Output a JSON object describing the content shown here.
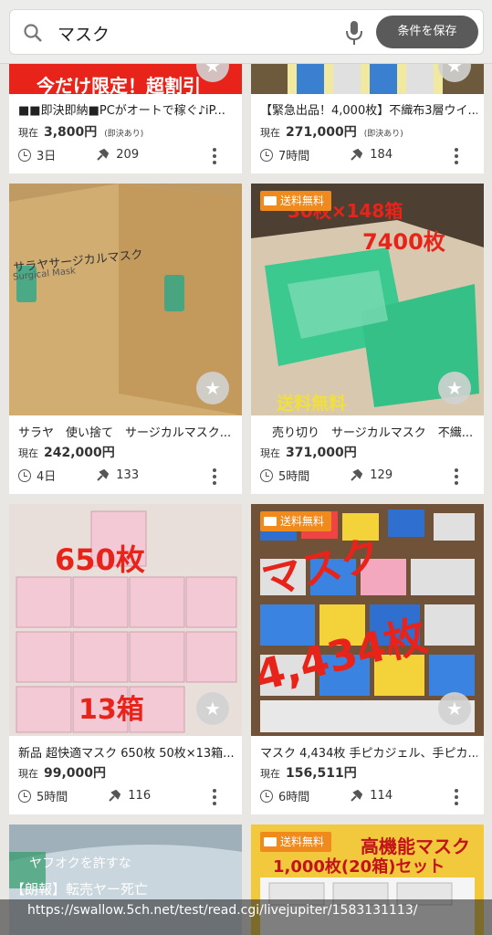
{
  "search": {
    "query": "マスク",
    "save_label": "条件を保存"
  },
  "badge_label": "送料無料",
  "items": [
    {
      "title": "■■即決即納■PCがオートで稼ぐ♪iP...",
      "price_label": "現在",
      "price": "3,800円",
      "note": "(即決あり)",
      "time": "3日",
      "bids": "209",
      "banner": "今だけ限定！超割引"
    },
    {
      "title": "【緊急出品！4,000枚】不織布3層ウイ...",
      "price_label": "現在",
      "price": "271,000円",
      "note": "(即決あり)",
      "time": "7時間",
      "bids": "184"
    },
    {
      "title": "サラヤ　使い捨て　サージカルマスク...",
      "price_label": "現在",
      "price": "242,000円",
      "time": "4日",
      "bids": "133",
      "box_text": "サラヤサージカルマスク",
      "box_sub": "Surgical Mask"
    },
    {
      "title": "　売り切り　サージカルマスク　不織...",
      "price_label": "現在",
      "price": "371,000円",
      "time": "5時間",
      "bids": "129",
      "img_line1": "30枚×148箱",
      "img_line2": "7400枚",
      "img_line3": "送料無料"
    },
    {
      "title": "新品 超快適マスク 650枚 50枚×13箱...",
      "price_label": "現在",
      "price": "99,000円",
      "time": "5時間",
      "bids": "116",
      "img_line1": "650枚",
      "img_line2": "13箱"
    },
    {
      "title": "マスク 4,434枚 手ピカジェル、手ピカ...",
      "price_label": "現在",
      "price": "156,511円",
      "time": "6時間",
      "bids": "114",
      "img_line1": "マスク",
      "img_line2": "4,434枚"
    },
    {
      "img_line1": "ヤフオクを許すな"
    },
    {
      "img_line1": "高機能マスク",
      "img_line2": "1,000枚(20箱)セット"
    }
  ],
  "watermark": {
    "line1": "【朗報】転売ヤー死亡",
    "line2": "https://swallow.5ch.net/test/read.cgi/livejupiter/1583131113/"
  },
  "colors": {
    "badge": "#f08a1c",
    "red": "#e8231a",
    "green_mask": "#3cc98f"
  }
}
